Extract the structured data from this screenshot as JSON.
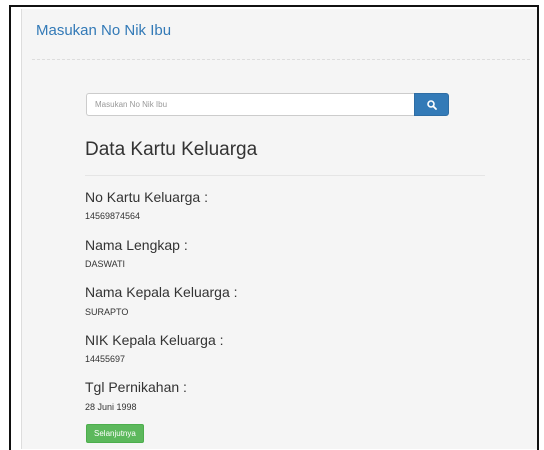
{
  "panel": {
    "title": "Masukan No Nik Ibu"
  },
  "search": {
    "placeholder": "Masukan No Nik Ibu",
    "value": "",
    "button_icon": "search-icon"
  },
  "section": {
    "heading": "Data Kartu Keluarga"
  },
  "fields": [
    {
      "label": "No Kartu Keluarga :",
      "value": "14569874564"
    },
    {
      "label": "Nama Lengkap :",
      "value": "DASWATI"
    },
    {
      "label": "Nama Kepala Keluarga :",
      "value": "SURAPTO"
    },
    {
      "label": "NIK Kepala Keluarga :",
      "value": "14455697"
    },
    {
      "label": "Tgl Pernikahan :",
      "value": "28 Juni 1998"
    }
  ],
  "actions": {
    "next_label": "Selanjutnya"
  },
  "colors": {
    "primary": "#337ab7",
    "success": "#5cb85c",
    "panel_background": "#f5f5f5"
  }
}
